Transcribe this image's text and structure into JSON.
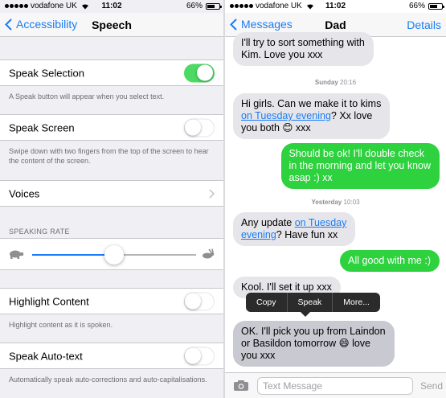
{
  "left_screen": {
    "status": {
      "carrier": "vodafone UK",
      "time": "11:02",
      "battery": "66%",
      "battery_level": 0.66
    },
    "nav": {
      "back_label": "Accessibility",
      "title": "Speech"
    },
    "speak_selection": {
      "label": "Speak Selection",
      "on": true,
      "footer": "A Speak button will appear when you select text."
    },
    "speak_screen": {
      "label": "Speak Screen",
      "on": false,
      "footer": "Swipe down with two fingers from the top of the screen to hear the content of the screen."
    },
    "voices": {
      "label": "Voices"
    },
    "speaking_rate": {
      "header": "SPEAKING RATE",
      "value": 0.5
    },
    "highlight_content": {
      "label": "Highlight Content",
      "on": false,
      "footer": "Highlight content as it is spoken."
    },
    "speak_auto_text": {
      "label": "Speak Auto-text",
      "on": false,
      "footer": "Automatically speak auto-corrections and auto-capitalisations."
    }
  },
  "right_screen": {
    "status": {
      "carrier": "vodafone UK",
      "time": "11:02",
      "battery": "66%",
      "battery_level": 0.66
    },
    "nav": {
      "back_label": "Messages",
      "title": "Dad",
      "details_label": "Details"
    },
    "messages": {
      "m1": {
        "line1": "I'll try to sort something with",
        "line2": "Kim. Love you xxx"
      },
      "ts1": {
        "day": "Sunday",
        "time": "20:16"
      },
      "m2": {
        "line1": "Hi girls.  Can we make it to kims",
        "link": "on Tuesday evening",
        "line2_rest": "? Xx love",
        "line3": "you both 😊 xxx"
      },
      "m3": {
        "line1": "Should be ok! I'll double check",
        "line2": "in the morning and let you know",
        "line3": "asap :) xx"
      },
      "ts2": {
        "day": "Yesterday",
        "time": "10:03"
      },
      "m4": {
        "line1_pre": "Any update ",
        "link1": "on Tuesday",
        "link2": "evening",
        "line2_rest": "? Have fun xx"
      },
      "m5": {
        "text": "All good with me :)"
      },
      "m6": {
        "text": "Kool.  I'll set it up xxx"
      },
      "m7": {
        "line1": "OK. I'll pick you up from Laindon",
        "line2": "or Basildon tomorrow 😄 love",
        "line3": "you xxx"
      }
    },
    "popup": {
      "copy": "Copy",
      "speak": "Speak",
      "more": "More..."
    },
    "input": {
      "placeholder": "Text Message",
      "send_label": "Send"
    },
    "colors": {
      "incoming": "#e5e5ea",
      "outgoing": "#2ed13e",
      "accent": "#1a7cf5"
    }
  }
}
